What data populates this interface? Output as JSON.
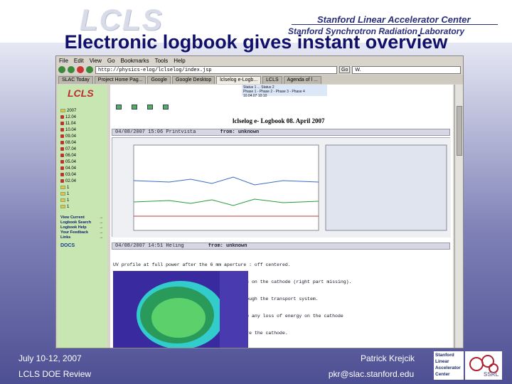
{
  "slide": {
    "logo_text": "LCLS",
    "org_line1": "Stanford Linear Accelerator Center",
    "org_line2": "Stanford Synchrotron Radiation Laboratory",
    "title": "Electronic logbook gives instant overview"
  },
  "browser": {
    "menu": [
      "File",
      "Edit",
      "View",
      "Go",
      "Bookmarks",
      "Tools",
      "Help"
    ],
    "url": "http://physics-elog/lclselog/index.jsp",
    "go_label": "Go",
    "search_value": "W.",
    "tabs": [
      "SLAC Today",
      "Project Home Pag...",
      "Google",
      "Google Desktop",
      "lclselog e-Logb...",
      "LCLS",
      "Agenda of l ..."
    ]
  },
  "sidebar": {
    "logo": "LCLS",
    "tree_items": [
      "2007",
      "12.04",
      "11.04",
      "10.04",
      "09.04",
      "08.04",
      "07.04",
      "06.04",
      "05.04",
      "04.04",
      "03.04",
      "02.04",
      "1",
      "1",
      "1",
      "1"
    ],
    "nav": [
      "View Current",
      "Logbook Search",
      "Logbook Help",
      "Your Feedback",
      "Links"
    ],
    "docs_label": "DOCS"
  },
  "content": {
    "status_lines": [
      "Status 1 ... Status 2",
      "Phase 1 - Phase 2 - Phase 3 - Phase 4"
    ],
    "status_time": "10.04.07 10:10",
    "page_title": "lclselog e- Logbook 08. April 2007",
    "entry1_time": "04/08/2007 15:06",
    "entry1_tag": "Printvista",
    "entry1_from": "from: unknown",
    "entry2_time": "04/08/2007 14:51",
    "entry2_tag": "Heling",
    "entry2_from": "from: unknown",
    "entry2_text": [
      "UV profile at full power after the 6 mm aperture : off centered.",
      "This is the reason why the beam was not symmetric on the cathode (right part missing).",
      "Alignment cut the drive laser was ok but not through the transport system.",
      "The misalignment on the aperture didn't introduce any loss of energy on the cathode",
      ": 1.6 uJ instead of 1.7 with the joulemeter before the cathode."
    ]
  },
  "footer": {
    "date": "July 10-12, 2007",
    "review": "LCLS DOE Review",
    "presenter": "Patrick Krejcik",
    "email": "pkr@slac.stanford.edu",
    "lab_lines": [
      "Stanford",
      "Linear",
      "Accelerator",
      "Center"
    ],
    "ssrl": "SSRL"
  },
  "colors": {
    "title": "#10106a",
    "sidebar_bg": "#c7e6b2",
    "slide_gradient_bottom": "#4d4f93"
  }
}
